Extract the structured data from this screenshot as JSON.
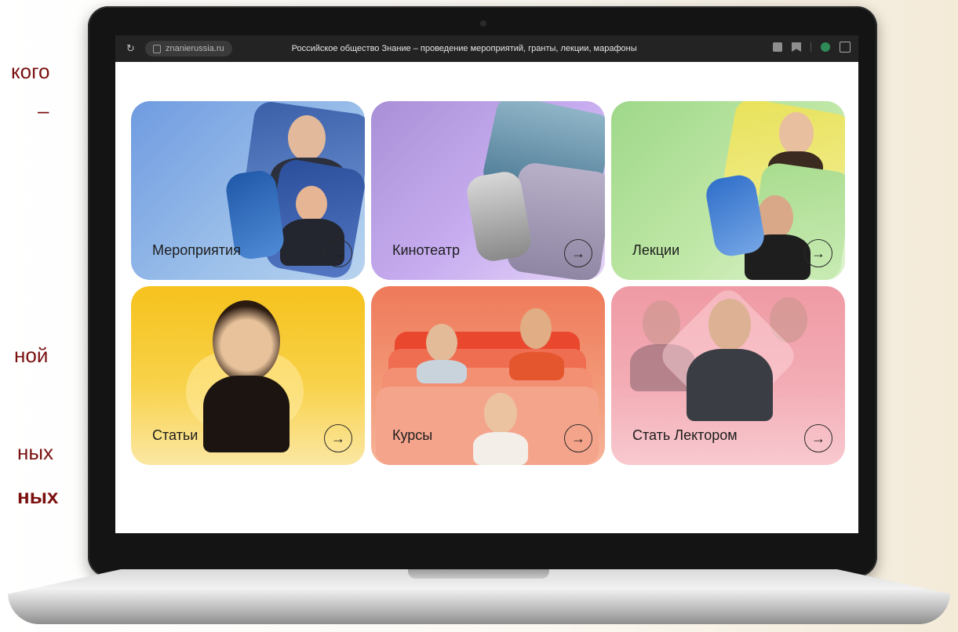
{
  "slide_fragments": [
    "кого",
    "–",
    "ной",
    "ных",
    "ных"
  ],
  "browser": {
    "url": "znanierussia.ru",
    "page_title": "Российское общество Знание – проведение мероприятий, гранты, лекции, марафоны"
  },
  "cards": [
    {
      "label": "Мероприятия",
      "arrow": "→",
      "color": "#8fb7e8"
    },
    {
      "label": "Кинотеатр",
      "arrow": "→",
      "color": "#c9a8e8"
    },
    {
      "label": "Лекции",
      "arrow": "→",
      "color": "#b8e39a"
    },
    {
      "label": "Статьи",
      "arrow": "→",
      "color": "#f7cf3a"
    },
    {
      "label": "Курсы",
      "arrow": "→",
      "color": "#f08a6c"
    },
    {
      "label": "Стать Лектором",
      "arrow": "→",
      "color": "#f4a8b2"
    }
  ]
}
